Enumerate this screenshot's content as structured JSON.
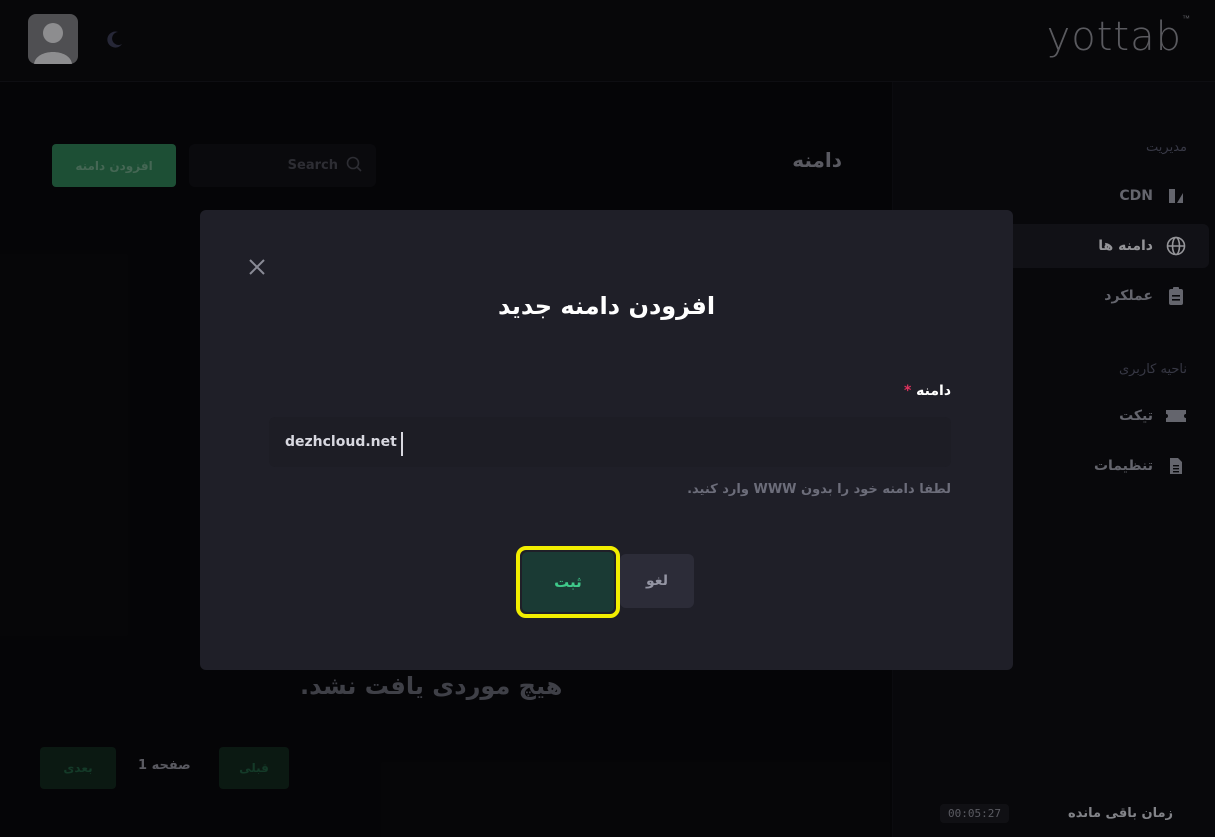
{
  "header": {
    "logo_text": "yottab",
    "logo_tm": "™"
  },
  "sidebar": {
    "section_management": "مدیریت",
    "section_user": "ناحیه کاربری",
    "items": [
      {
        "label": "CDN",
        "icon": "cdn-icon"
      },
      {
        "label": "دامنه ها",
        "icon": "globe-icon",
        "active": true
      },
      {
        "label": "عملکرد",
        "icon": "clipboard-icon"
      },
      {
        "label": "تیکت",
        "icon": "ticket-icon"
      },
      {
        "label": "تنظیمات",
        "icon": "document-icon"
      }
    ],
    "timer_label": "زمان باقی مانده",
    "timer_value": "00:05:27"
  },
  "main": {
    "title": "دامنه",
    "search_placeholder": "Search",
    "add_button": "افزودن دامنه",
    "empty_text": "هیچ موردی یافت نشد.",
    "pagination": {
      "next": "بعدی",
      "page_label": "صفحه 1",
      "prev": "قبلی"
    }
  },
  "modal": {
    "title": "افزودن دامنه جدید",
    "field_label": "دامنه",
    "required_mark": "*",
    "input_value": "dezhcloud.net",
    "help_text": "لطفا دامنه خود را بدون WWW وارد کنید.",
    "cancel": "لغو",
    "submit": "ثبت"
  },
  "colors": {
    "accent_green": "#2d7a52",
    "highlight": "#f2ee00",
    "required": "#e0335e"
  }
}
